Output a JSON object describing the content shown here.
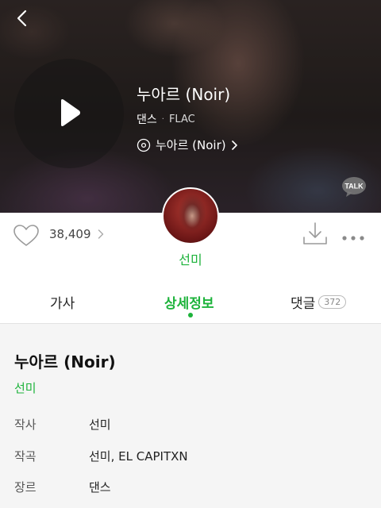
{
  "hero": {
    "title": "누아르 (Noir)",
    "genre": "댄스",
    "separator": "·",
    "format": "FLAC",
    "album": "누아르 (Noir)",
    "talk_badge": "TALK"
  },
  "info": {
    "like_count": "38,409",
    "artist": "선미"
  },
  "tabs": {
    "lyrics": "가사",
    "details": "상세정보",
    "comments": "댓글",
    "comment_count": "372",
    "active": "details"
  },
  "details": {
    "title": "누아르 (Noir)",
    "artist": "선미",
    "rows": [
      {
        "label": "작사",
        "value": "선미"
      },
      {
        "label": "작곡",
        "value": "선미, EL CAPITXN"
      },
      {
        "label": "장르",
        "value": "댄스"
      }
    ]
  },
  "colors": {
    "accent": "#1db33b"
  },
  "icons": [
    "back-arrow-icon",
    "play-icon",
    "disc-icon",
    "chevron-right-icon",
    "kakaotalk-icon",
    "heart-icon",
    "download-icon",
    "more-icon"
  ]
}
